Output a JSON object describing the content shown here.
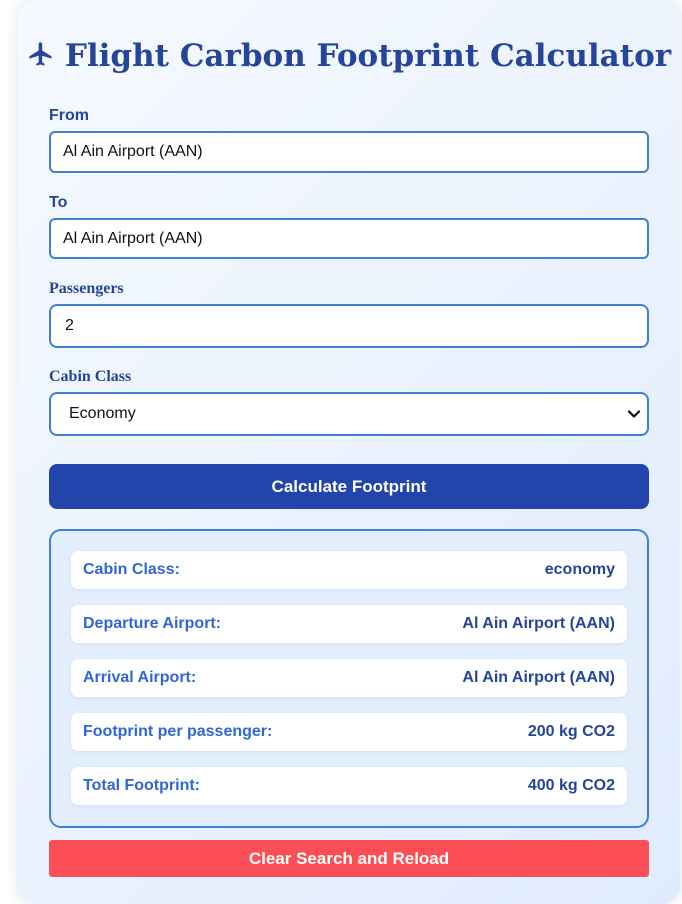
{
  "header": {
    "title": "Flight Carbon Footprint Calculator",
    "icon": "airplane-icon"
  },
  "form": {
    "from": {
      "label": "From",
      "value": "Al Ain Airport (AAN)"
    },
    "to": {
      "label": "To",
      "value": "Al Ain Airport (AAN)"
    },
    "passengers": {
      "label": "Passengers",
      "value": "2"
    },
    "cabin_class": {
      "label": "Cabin Class",
      "selected": "Economy"
    },
    "calculate_label": "Calculate Footprint"
  },
  "results": {
    "rows": [
      {
        "key": "Cabin Class:",
        "value": "economy"
      },
      {
        "key": "Departure Airport:",
        "value": "Al Ain Airport (AAN)"
      },
      {
        "key": "Arrival Airport:",
        "value": "Al Ain Airport (AAN)"
      },
      {
        "key": "Footprint per passenger:",
        "value": "200 kg CO2"
      },
      {
        "key": "Total Footprint:",
        "value": "400 kg CO2"
      }
    ]
  },
  "clear_label": "Clear Search and Reload",
  "colors": {
    "primary": "#2245ab",
    "accent": "#3f7fd9",
    "danger": "#fb4e56",
    "heading": "#24459a"
  }
}
